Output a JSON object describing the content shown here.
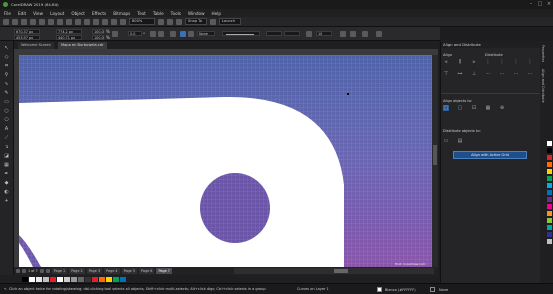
{
  "window": {
    "title": "CorelDRAW 2019 (64-Bit)",
    "close": "×",
    "maximize": "□",
    "minimize": "–"
  },
  "menu": [
    "File",
    "Edit",
    "View",
    "Layout",
    "Object",
    "Effects",
    "Bitmaps",
    "Text",
    "Table",
    "Tools",
    "Window",
    "Help"
  ],
  "toolbar": {
    "zoom": "800%",
    "snap_to": "Snap To",
    "launch": "Launch"
  },
  "propbar": {
    "x": "670.37 px",
    "y": "453.97 px",
    "w": "774.2 px",
    "h": "440.71 px",
    "scale_x": "100.0",
    "scale_y": "100.0",
    "pct": "%",
    "angle": "0.0",
    "deg": "°",
    "outline": "None",
    "outline_width": "10",
    "corner": "0"
  },
  "tabs": {
    "welcome": "Welcome Screen",
    "doc": "Mapa en Burbuwela.cdr"
  },
  "pagenav": {
    "counter": "1 of 7",
    "pages": [
      "Page 1",
      "Page 2",
      "Page 3",
      "Page 4",
      "Page 5",
      "Page 6",
      "Page 7"
    ]
  },
  "canvas": {
    "watermark": "Hint: Coreldraw.com"
  },
  "palette": {
    "colors": [
      "#000000",
      "#ffffff",
      "#e8e8e8",
      "#c0c0c0",
      "#e4202a",
      "#ffffff",
      "#cccccc",
      "#999999",
      "#666666",
      "#333333",
      "#e51f2a",
      "#ff6b00",
      "#ffd100",
      "#00a651",
      "#0072bc"
    ]
  },
  "status": {
    "hint": "Click an object twice for rotating/skewing; dbl-clicking tool selects all objects; Shift+click multi-selects; Alt+click digs; Ctrl+click selects in a group",
    "layer": "Curves on Layer 1",
    "fill": "Blanco (#FFFFFF)",
    "outline": "None"
  },
  "dock": {
    "title": "Align and Distribute",
    "align_label": "Align",
    "distribute_label": "Distribute",
    "align_to_label": "Align objects to:",
    "distribute_to_label": "Distribute objects to:",
    "align_button": "Align with Active Grid",
    "side_tabs": [
      "Align and Distribute",
      "Properties"
    ]
  },
  "rightpalette": [
    "#ffffff",
    "#000000",
    "#e4202a",
    "#ff6b00",
    "#ffd100",
    "#00a651",
    "#00aeef",
    "#0072bc",
    "#662d91",
    "#ec008c",
    "#f7941d",
    "#8dc63f",
    "#00a99d",
    "#2e3192",
    "#c0c0c0"
  ]
}
